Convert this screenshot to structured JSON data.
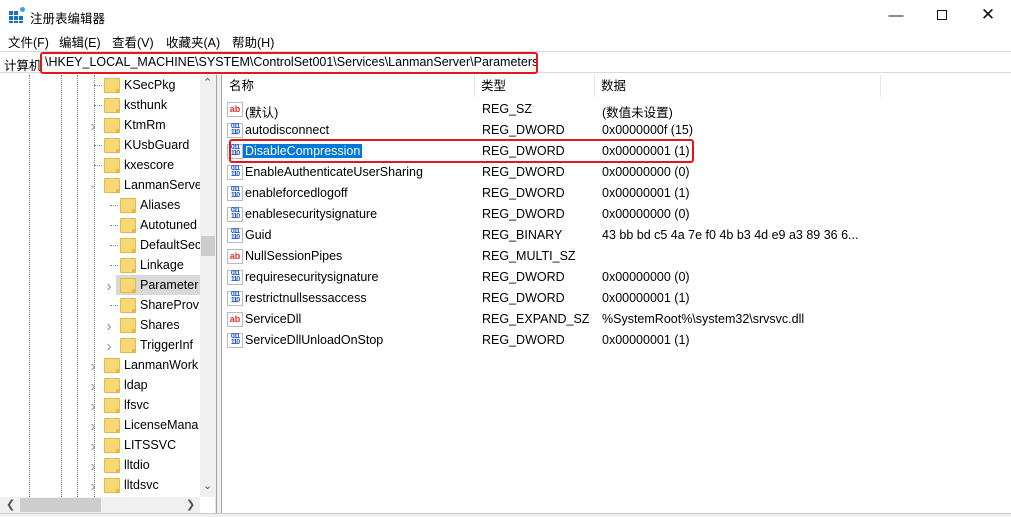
{
  "window": {
    "title": "注册表编辑器",
    "minimize_icon": "minimize-icon",
    "maximize_icon": "maximize-icon",
    "close_icon": "close-icon"
  },
  "menu": [
    "文件(F)",
    "编辑(E)",
    "查看(V)",
    "收藏夹(A)",
    "帮助(H)"
  ],
  "address": {
    "label": "计算机",
    "path": "\\HKEY_LOCAL_MACHINE\\SYSTEM\\ControlSet001\\Services\\LanmanServer\\Parameters",
    "highlight_color": "#e8161b"
  },
  "tree": [
    {
      "label": "KSecPkg",
      "level": 1,
      "expander": "none"
    },
    {
      "label": "ksthunk",
      "level": 1,
      "expander": "none"
    },
    {
      "label": "KtmRm",
      "level": 1,
      "expander": "collapsed"
    },
    {
      "label": "KUsbGuard",
      "level": 1,
      "expander": "none"
    },
    {
      "label": "kxescore",
      "level": 1,
      "expander": "none"
    },
    {
      "label": "LanmanServe",
      "level": 1,
      "expander": "expanded"
    },
    {
      "label": "Aliases",
      "level": 2,
      "expander": "none"
    },
    {
      "label": "Autotuned",
      "level": 2,
      "expander": "none"
    },
    {
      "label": "DefaultSec",
      "level": 2,
      "expander": "none"
    },
    {
      "label": "Linkage",
      "level": 2,
      "expander": "none"
    },
    {
      "label": "Parameter",
      "level": 2,
      "expander": "collapsed",
      "selected": true
    },
    {
      "label": "ShareProv",
      "level": 2,
      "expander": "none"
    },
    {
      "label": "Shares",
      "level": 2,
      "expander": "collapsed"
    },
    {
      "label": "TriggerInf",
      "level": 2,
      "expander": "collapsed"
    },
    {
      "label": "LanmanWork",
      "level": 1,
      "expander": "collapsed"
    },
    {
      "label": "ldap",
      "level": 1,
      "expander": "collapsed"
    },
    {
      "label": "lfsvc",
      "level": 1,
      "expander": "collapsed"
    },
    {
      "label": "LicenseMana",
      "level": 1,
      "expander": "collapsed"
    },
    {
      "label": "LITSSVC",
      "level": 1,
      "expander": "collapsed"
    },
    {
      "label": "lltdio",
      "level": 1,
      "expander": "collapsed"
    },
    {
      "label": "lltdsvc",
      "level": 1,
      "expander": "collapsed"
    }
  ],
  "columns": [
    "名称",
    "类型",
    "数据"
  ],
  "values": [
    {
      "name": "(默认)",
      "type": "REG_SZ",
      "data": "(数值未设置)",
      "icon": "string"
    },
    {
      "name": "autodisconnect",
      "type": "REG_DWORD",
      "data": "0x0000000f (15)",
      "icon": "binary"
    },
    {
      "name": "DisableCompression",
      "type": "REG_DWORD",
      "data": "0x00000001 (1)",
      "icon": "binary",
      "selected": true,
      "highlighted": true
    },
    {
      "name": "EnableAuthenticateUserSharing",
      "type": "REG_DWORD",
      "data": "0x00000000 (0)",
      "icon": "binary"
    },
    {
      "name": "enableforcedlogoff",
      "type": "REG_DWORD",
      "data": "0x00000001 (1)",
      "icon": "binary"
    },
    {
      "name": "enablesecuritysignature",
      "type": "REG_DWORD",
      "data": "0x00000000 (0)",
      "icon": "binary"
    },
    {
      "name": "Guid",
      "type": "REG_BINARY",
      "data": "43 bb bd c5 4a 7e f0 4b b3 4d e9 a3 89 36 6...",
      "icon": "binary"
    },
    {
      "name": "NullSessionPipes",
      "type": "REG_MULTI_SZ",
      "data": "",
      "icon": "string"
    },
    {
      "name": "requiresecuritysignature",
      "type": "REG_DWORD",
      "data": "0x00000000 (0)",
      "icon": "binary"
    },
    {
      "name": "restrictnullsessaccess",
      "type": "REG_DWORD",
      "data": "0x00000001 (1)",
      "icon": "binary"
    },
    {
      "name": "ServiceDll",
      "type": "REG_EXPAND_SZ",
      "data": "%SystemRoot%\\system32\\srvsvc.dll",
      "icon": "string"
    },
    {
      "name": "ServiceDllUnloadOnStop",
      "type": "REG_DWORD",
      "data": "0x00000001 (1)",
      "icon": "binary"
    }
  ],
  "colors": {
    "selection": "#0078d7",
    "highlight_box": "#e8161b",
    "folder": "#f8d775"
  }
}
